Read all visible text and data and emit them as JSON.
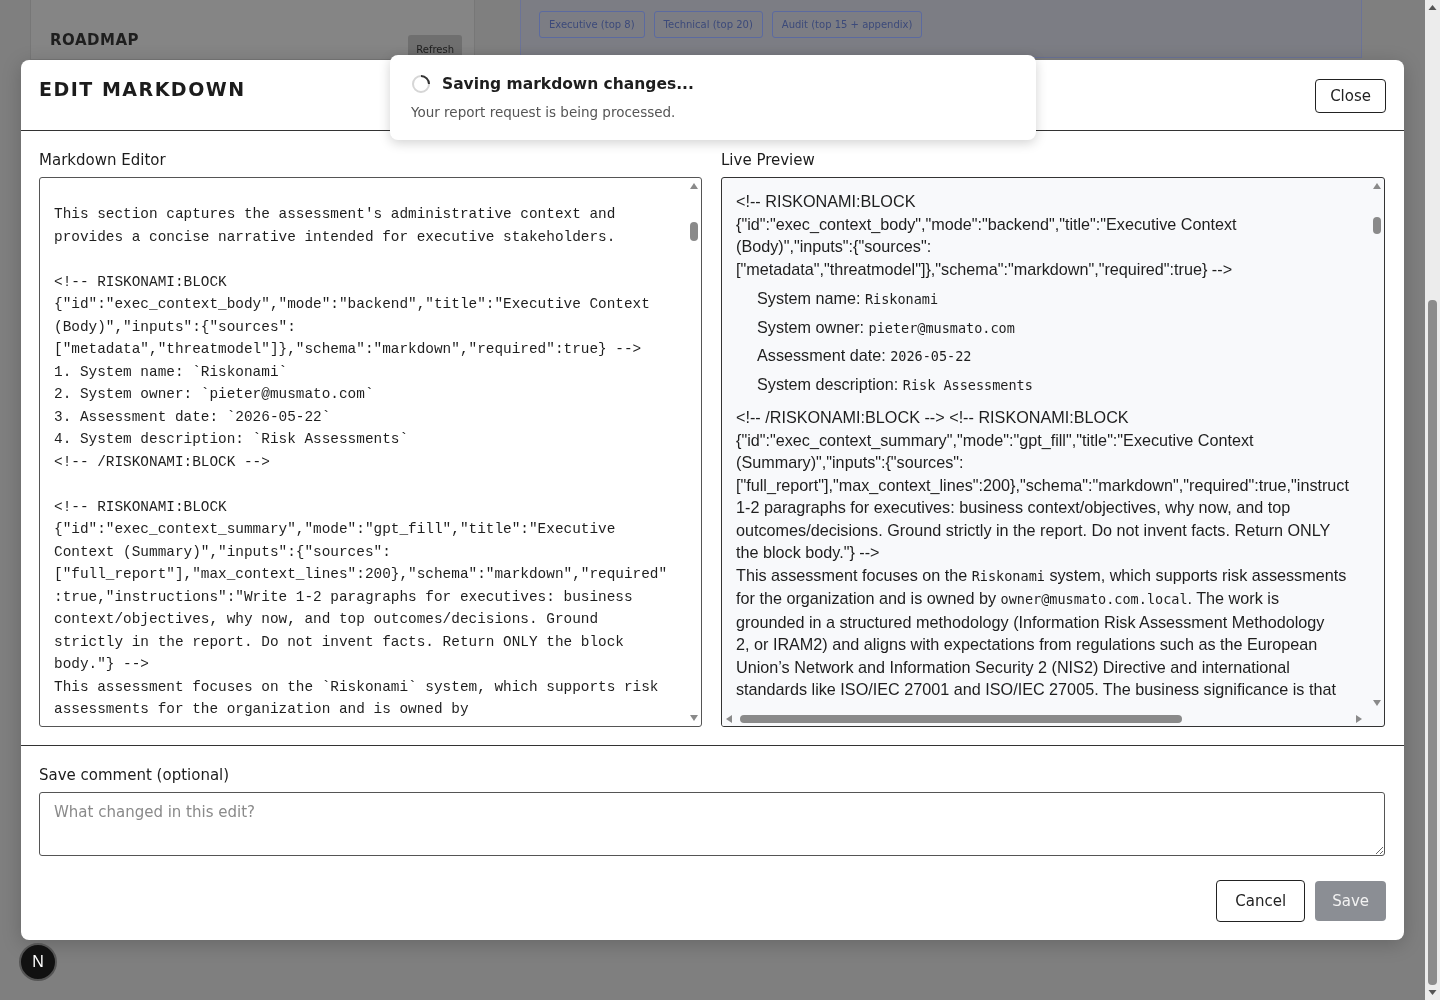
{
  "background_page": {
    "roadmap_title": "ROADMAP",
    "refresh_button": "Refresh",
    "report_presets": [
      {
        "label": "Executive (top 8)"
      },
      {
        "label": "Technical (top 20)"
      },
      {
        "label": "Audit (top 15 + appendix)"
      }
    ]
  },
  "modal": {
    "title": "EDIT MARKDOWN",
    "close_button": "Close",
    "editor": {
      "label": "Markdown Editor",
      "blocks": [
        [
          "This section captures the assessment's administrative context and provides a concise narrative intended for executive stakeholders."
        ],
        [
          "<!-- RISKONAMI:BLOCK",
          "{\"id\":\"exec_context_body\",\"mode\":\"backend\",\"title\":\"Executive Context (Body)\",\"inputs\":{\"sources\":[\"metadata\",\"threatmodel\"]},\"schema\":\"markdown\",\"required\":true} -->",
          "1. System name: `Riskonami`",
          "2. System owner: `pieter@musmato.com`",
          "3. Assessment date: `2026-05-22`",
          "4. System description: `Risk Assessments`",
          "<!-- /RISKONAMI:BLOCK -->"
        ],
        [
          "<!-- RISKONAMI:BLOCK",
          "{\"id\":\"exec_context_summary\",\"mode\":\"gpt_fill\",\"title\":\"Executive Context (Summary)\",\"inputs\":{\"sources\":[\"full_report\"],\"max_context_lines\":200},\"schema\":\"markdown\",\"required\"",
          ":true,\"instructions\":\"Write 1-2 paragraphs for executives: business context/objectives, why now, and top outcomes/decisions. Ground strictly in the report. Do not invent facts. Return ONLY the block body.\"} -->",
          "This assessment focuses on the `Riskonami` system, which supports risk assessments for the organization and is owned by"
        ]
      ]
    },
    "preview": {
      "label": "Live Preview",
      "blocks": [
        {
          "kind": "text",
          "lines": [
            "<!-- RISKONAMI:BLOCK",
            "{\"id\":\"exec_context_body\",\"mode\":\"backend\",\"title\":\"Executive Context",
            "(Body)\",\"inputs\":{\"sources\":",
            "[\"metadata\",\"threatmodel\"]},\"schema\":\"markdown\",\"required\":true} -->"
          ]
        },
        {
          "kind": "list",
          "items": [
            {
              "label": "System name: ",
              "value": "Riskonami"
            },
            {
              "label": "System owner: ",
              "value": "pieter@musmato.com"
            },
            {
              "label": "Assessment date: ",
              "value": "2026-05-22"
            },
            {
              "label": "System description: ",
              "value": "Risk Assessments"
            }
          ]
        },
        {
          "kind": "text",
          "lines": [
            "<!-- /RISKONAMI:BLOCK --> <!-- RISKONAMI:BLOCK",
            "{\"id\":\"exec_context_summary\",\"mode\":\"gpt_fill\",\"title\":\"Executive Context",
            "(Summary)\",\"inputs\":{\"sources\":",
            "[\"full_report\"],\"max_context_lines\":200},\"schema\":\"markdown\",\"required\":true,\"instruct",
            "1-2 paragraphs for executives: business context/objectives, why now, and top",
            "outcomes/decisions. Ground strictly in the report. Do not invent facts. Return ONLY",
            "the block body.\"} -->",
            [
              {
                "text": "This assessment focuses on the ",
                "kind": "plain"
              },
              {
                "text": "Riskonami",
                "kind": "code"
              },
              {
                "text": " system, which supports risk assessments",
                "kind": "plain"
              }
            ],
            [
              {
                "text": "for the organization and is owned by ",
                "kind": "plain"
              },
              {
                "text": "owner@musmato.com.local",
                "kind": "code"
              },
              {
                "text": ". The work is",
                "kind": "plain"
              }
            ],
            "grounded in a structured methodology (Information Risk Assessment Methodology",
            "2, or IRAM2) and aligns with expectations from regulations such as the European",
            "Union’s Network and Information Security 2 (NIS2) Directive and international",
            "standards like ISO/IEC 27001 and ISO/IEC 27005. The business significance is that"
          ]
        }
      ]
    },
    "comment": {
      "label": "Save comment (optional)",
      "placeholder": "What changed in this edit?"
    },
    "buttons": [
      {
        "label": "Cancel",
        "kind": "secondary",
        "disabled": false
      },
      {
        "label": "Save",
        "kind": "primary",
        "disabled": true
      }
    ]
  },
  "toast": {
    "title": "Saving markdown changes...",
    "message": "Your report request is being processed."
  },
  "dev_badge": {
    "label": "N"
  }
}
